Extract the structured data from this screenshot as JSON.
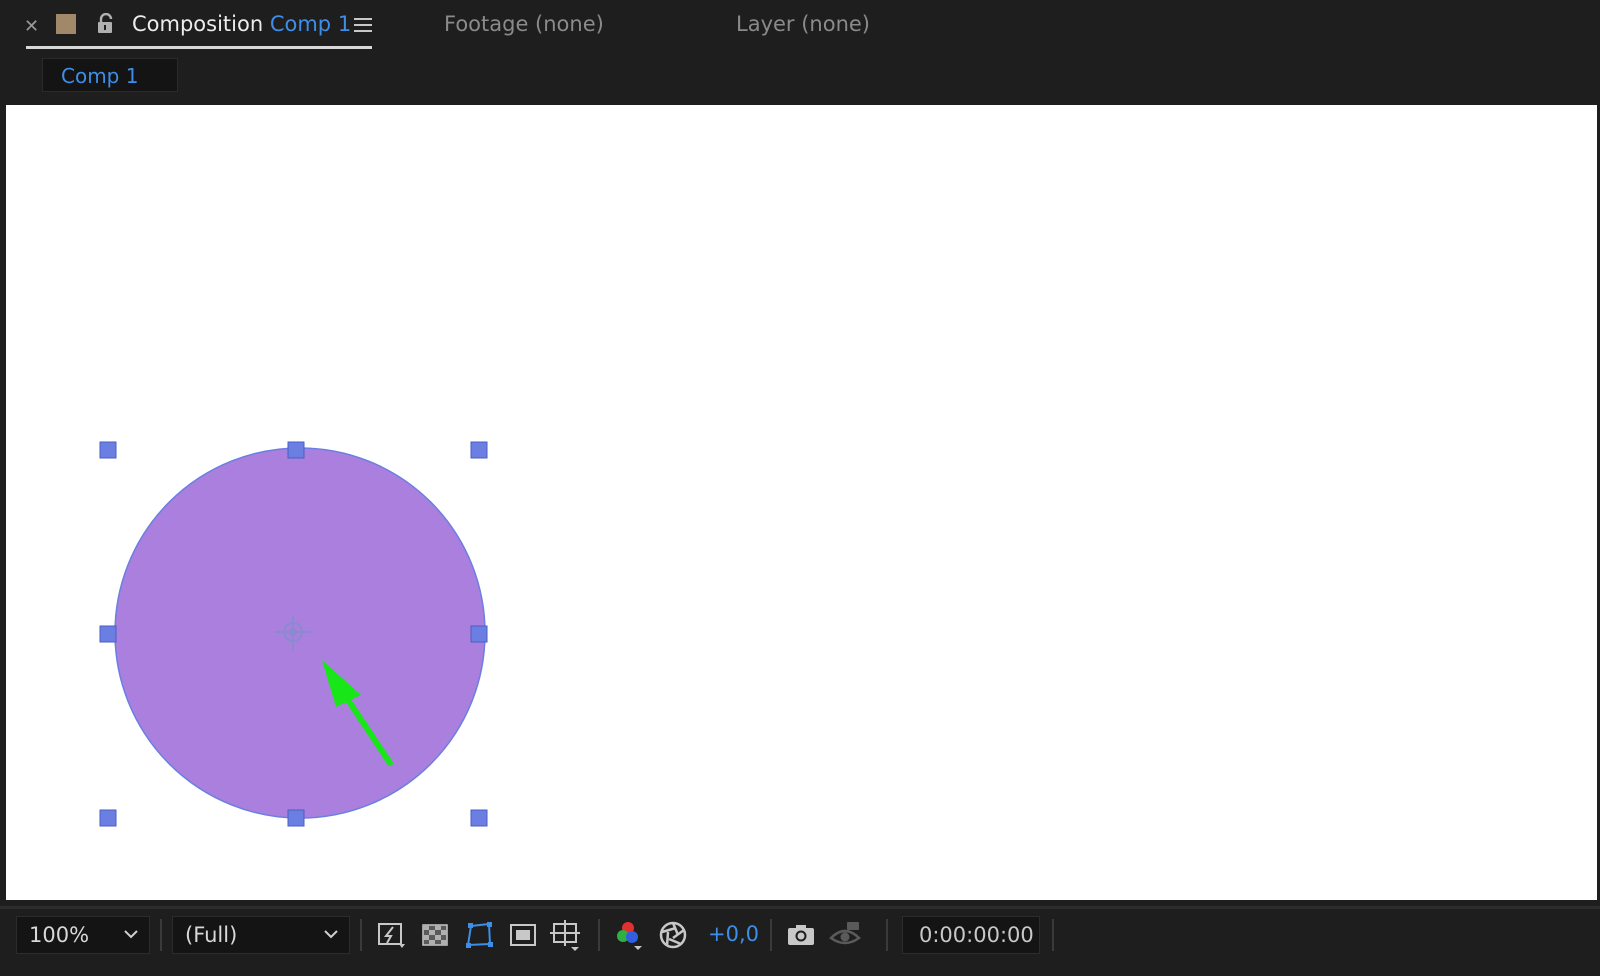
{
  "tabs": {
    "composition": {
      "prefix": "Composition",
      "name": "Comp 1",
      "label_color": "#3d8ee8",
      "swatch_color": "#a08868"
    },
    "footage": {
      "label": "Footage (none)"
    },
    "layer": {
      "label": "Layer (none)"
    }
  },
  "breadcrumb": {
    "label": "Comp 1"
  },
  "viewer": {
    "background": "#ffffff",
    "shape_fill": "#ab7fdd",
    "handle_color": "#6b7fe2",
    "arrow_color": "#19e619"
  },
  "toolbar": {
    "magnification": "100%",
    "resolution": "(Full)",
    "exposure": "+0,0",
    "timecode": "0:00:00:00",
    "icons": [
      "fast-previews-icon",
      "transparency-grid-icon",
      "mask-path-visibility-icon",
      "region-of-interest-icon",
      "grid-guides-icon",
      "color-channel-icon",
      "reset-exposure-icon",
      "snapshot-icon",
      "show-snapshot-icon"
    ]
  }
}
